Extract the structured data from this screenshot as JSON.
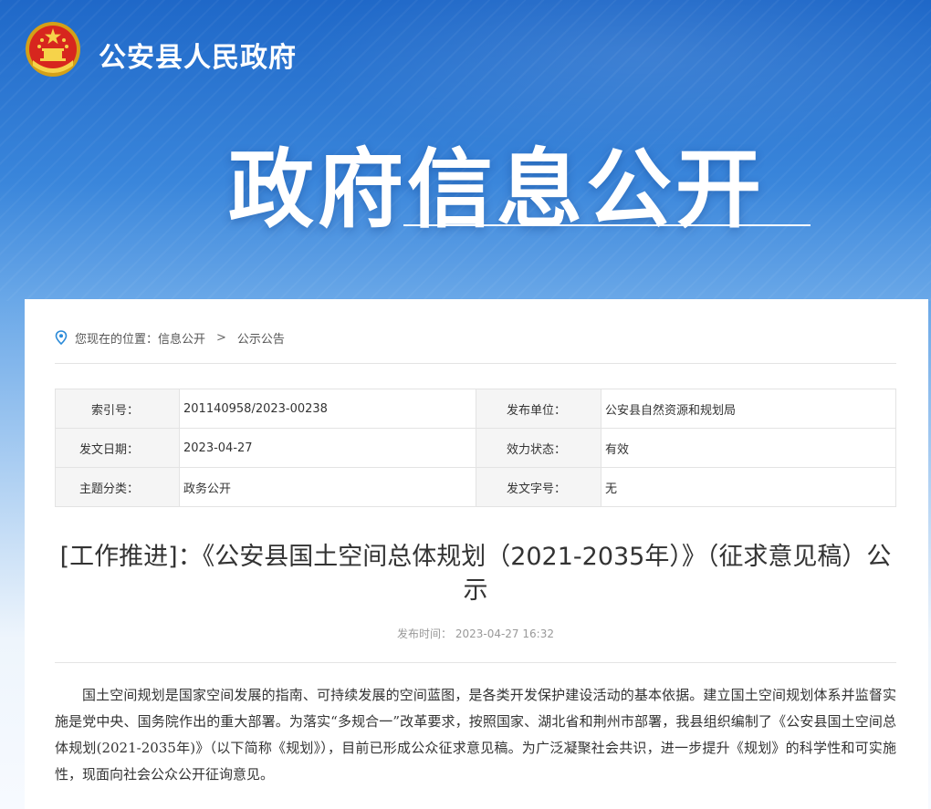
{
  "header": {
    "site_name": "公安县人民政府",
    "hero_title": "政府信息公开",
    "emblem_icon": "national-emblem-icon"
  },
  "breadcrumb": {
    "icon": "location-pin-icon",
    "prefix": "您现在的位置：信息公开",
    "separator": ">",
    "current": "公示公告"
  },
  "meta": {
    "index_no_label": "索引号：",
    "index_no": "201140958/2023-00238",
    "publisher_label": "发布单位：",
    "publisher": "公安县自然资源和规划局",
    "date_label": "发文日期：",
    "date": "2023-04-27",
    "status_label": "效力状态：",
    "status": "有效",
    "category_label": "主题分类：",
    "category": "政务公开",
    "doc_no_label": "发文字号：",
    "doc_no": "无"
  },
  "article": {
    "title": "[工作推进]：《公安县国土空间总体规划（2021-2035年）》（征求意见稿）公示",
    "publish_time": "发布时间： 2023-04-27 16:32",
    "paragraph": "国土空间规划是国家空间发展的指南、可持续发展的空间蓝图，是各类开发保护建设活动的基本依据。建立国土空间规划体系并监督实施是党中央、国务院作出的重大部署。为落实“多规合一”改革要求，按照国家、湖北省和荆州市部署，我县组织编制了《公安县国土空间总体规划(2021-2035年)》（以下简称《规划》），目前已形成公众征求意见稿。为广泛凝聚社会共识，进一步提升《规划》的科学性和可实施性，现面向社会公众公开征询意见。"
  },
  "colors": {
    "banner_blue": "#1f68c8",
    "text": "#333333"
  }
}
